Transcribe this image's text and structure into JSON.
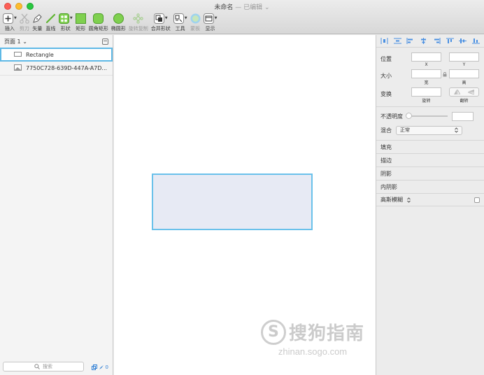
{
  "window": {
    "title": "未命名",
    "separator": " — ",
    "status": "已编辑",
    "status_caret": "⌄"
  },
  "toolbar": [
    {
      "label": "插入",
      "icon": "plus-icon",
      "disabled": false
    },
    {
      "label": "剪刀",
      "icon": "scissors-icon",
      "disabled": true
    },
    {
      "label": "矢量",
      "icon": "pen-icon",
      "disabled": false
    },
    {
      "label": "直线",
      "icon": "line-icon",
      "disabled": false
    },
    {
      "label": "形状",
      "icon": "shapes-icon",
      "disabled": false
    },
    {
      "label": "矩形",
      "icon": "rectangle-icon",
      "disabled": false
    },
    {
      "label": "圆角矩形",
      "icon": "rounded-rectangle-icon",
      "disabled": false
    },
    {
      "label": "椭圆形",
      "icon": "oval-icon",
      "disabled": false
    },
    {
      "label": "旋转复制",
      "icon": "rotate-copy-icon",
      "disabled": true
    },
    {
      "label": "合并形状",
      "icon": "combine-shapes-icon",
      "disabled": false
    },
    {
      "label": "工具",
      "icon": "tools-icon",
      "disabled": false
    },
    {
      "label": "蒙板",
      "icon": "mask-icon",
      "disabled": true
    },
    {
      "label": "显示",
      "icon": "view-icon",
      "disabled": false
    }
  ],
  "sidebar": {
    "page_label": "页面 1",
    "page_caret": "⌄",
    "layers": [
      {
        "name": "Rectangle",
        "selected": true
      },
      {
        "name": "7750C728-639D-447A-A7D...",
        "selected": false
      }
    ],
    "search_placeholder": "搜索",
    "bottom_count": "0"
  },
  "inspector": {
    "position_label": "位置",
    "x_caption": "X",
    "y_caption": "Y",
    "size_label": "大小",
    "width_caption": "宽",
    "height_caption": "高",
    "transform_label": "变换",
    "rotate_caption": "旋转",
    "flip_caption": "翻转",
    "opacity_label": "不透明度",
    "blend_label": "混合",
    "blend_value": "正常",
    "sections": [
      "填充",
      "描边",
      "阴影",
      "内阴影"
    ],
    "blur_label": "高斯模糊"
  },
  "watermark": {
    "brand": "搜狗指南",
    "url": "zhinan.sogo.com",
    "logo_letter": "S"
  },
  "colors": {
    "selection": "#5fb9e6",
    "shape_fill": "#e7eaf4",
    "tool_green": "#6cc644"
  }
}
